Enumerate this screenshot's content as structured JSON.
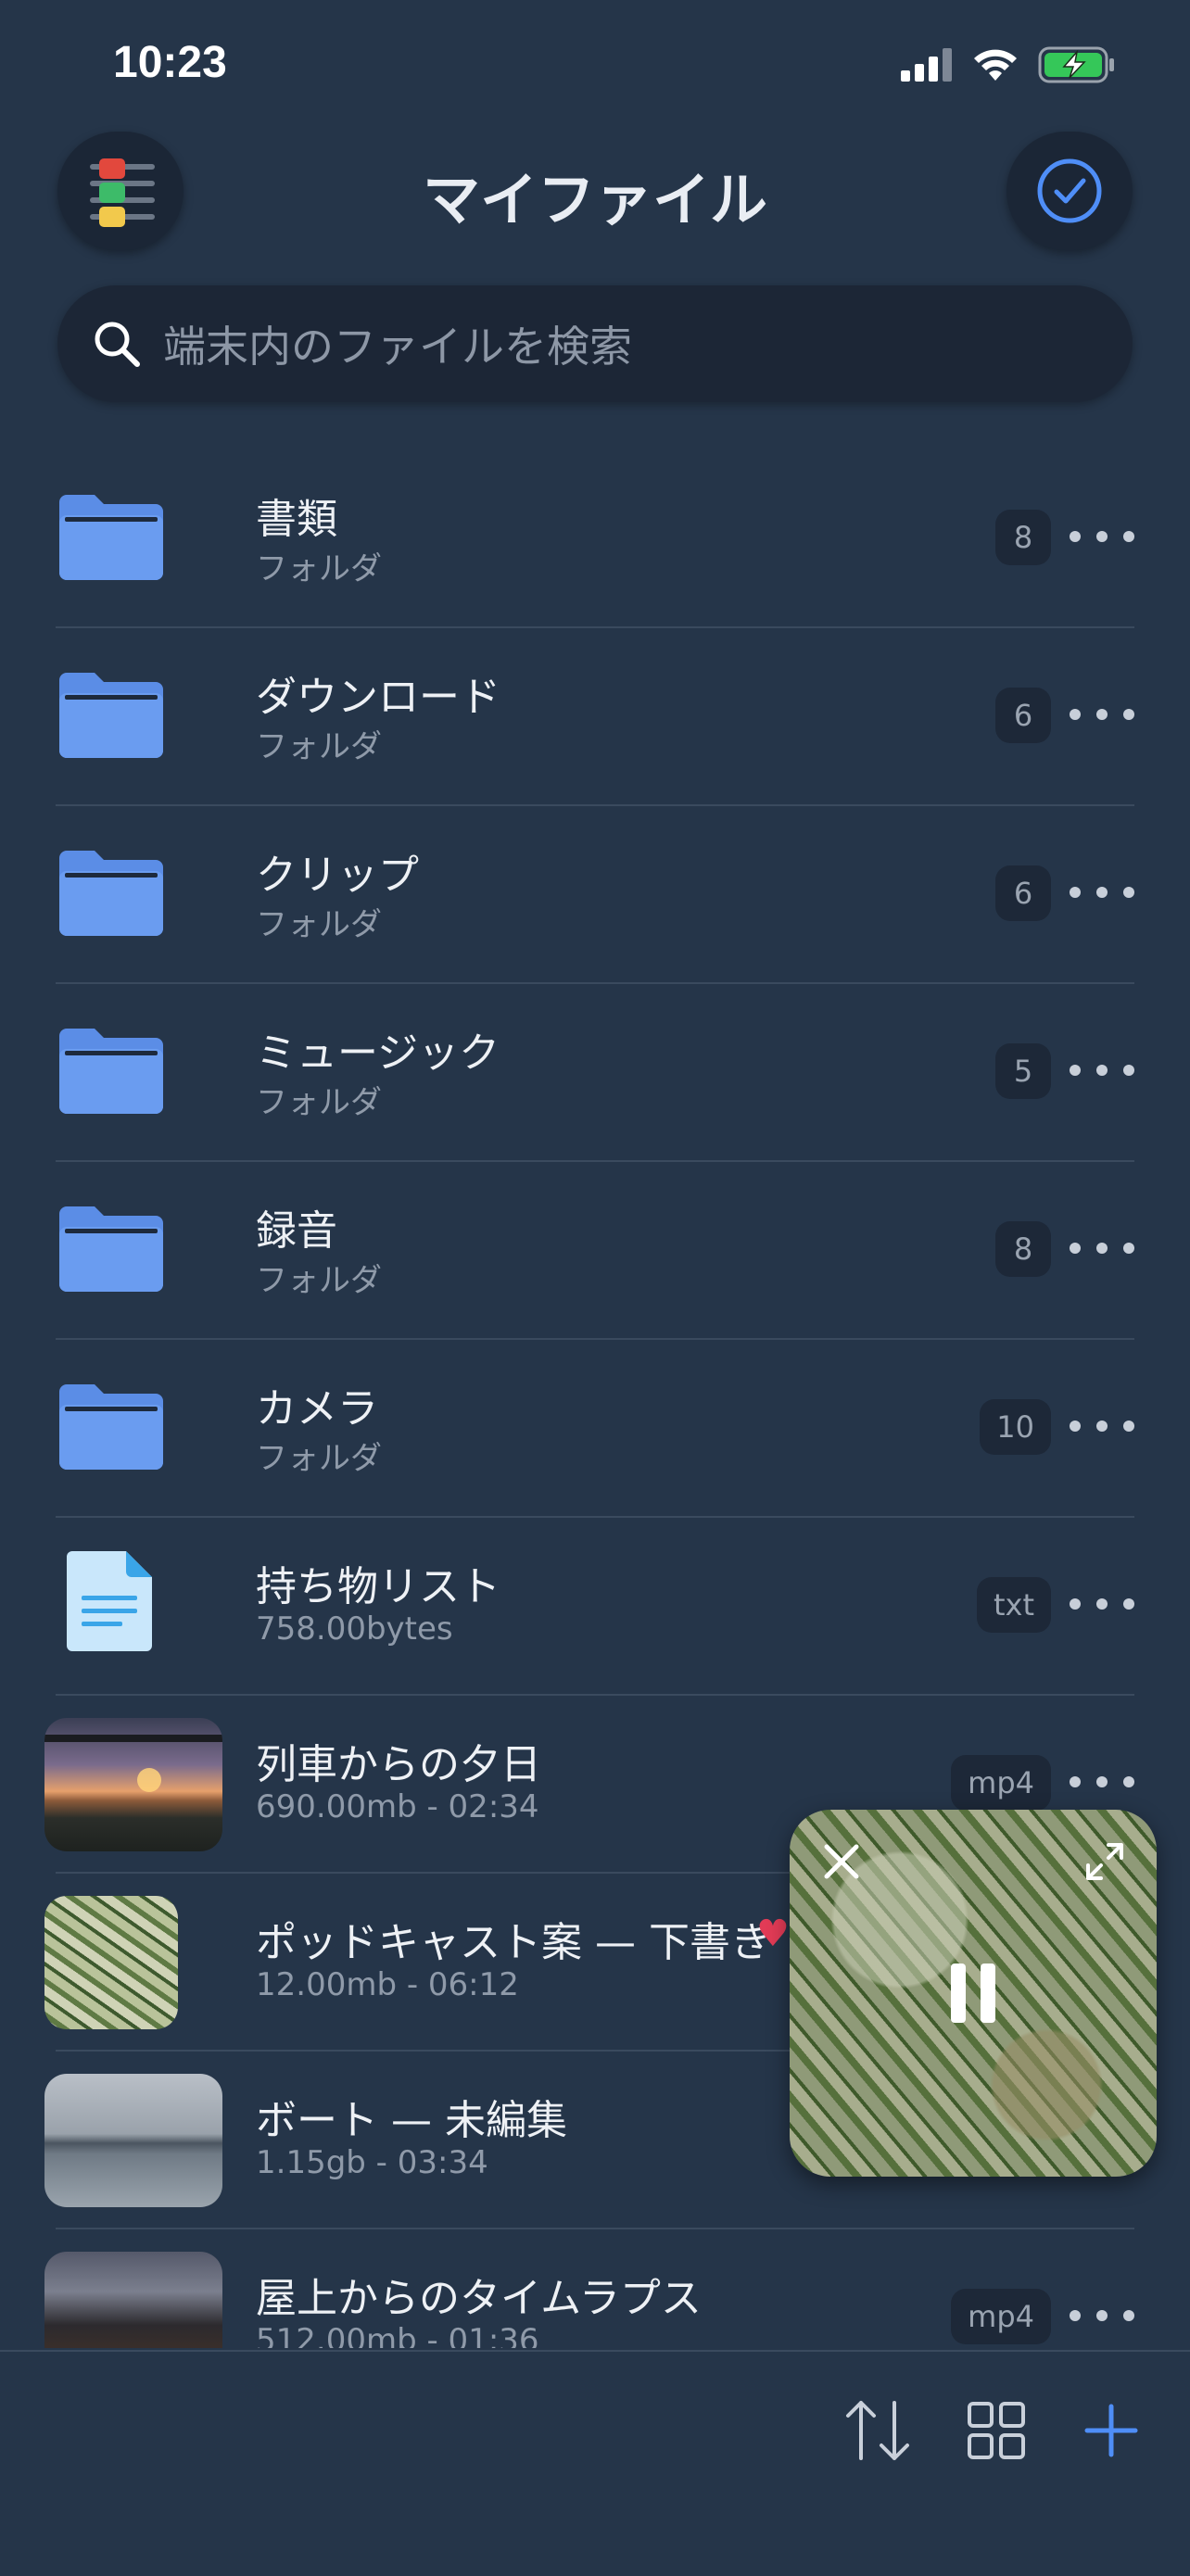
{
  "status_bar": {
    "time": "10:23"
  },
  "header": {
    "title": "マイファイル"
  },
  "search": {
    "placeholder": "端末内のファイルを検索"
  },
  "colors": {
    "accent": "#4f8ef7",
    "folder": "#5b8de6",
    "heart": "#e23b56",
    "background": "#253549"
  },
  "items": [
    {
      "name": "書類",
      "sub": "フォルダ",
      "badge": "8",
      "type": "folder"
    },
    {
      "name": "ダウンロード",
      "sub": "フォルダ",
      "badge": "6",
      "type": "folder"
    },
    {
      "name": "クリップ",
      "sub": "フォルダ",
      "badge": "6",
      "type": "folder"
    },
    {
      "name": "ミュージック",
      "sub": "フォルダ",
      "badge": "5",
      "type": "folder"
    },
    {
      "name": "録音",
      "sub": "フォルダ",
      "badge": "8",
      "type": "folder"
    },
    {
      "name": "カメラ",
      "sub": "フォルダ",
      "badge": "10",
      "type": "folder"
    },
    {
      "name": "持ち物リスト",
      "sub": "758.00bytes",
      "badge": "txt",
      "type": "text-file"
    },
    {
      "name": "列車からの夕日",
      "sub": "690.00mb - 02:34",
      "badge": "mp4",
      "type": "video"
    },
    {
      "name": "ポッドキャスト案 — 下書き",
      "sub": "12.00mb - 06:12",
      "badge": "",
      "type": "audio",
      "favorite": true
    },
    {
      "name": "ボート — 未編集",
      "sub": "1.15gb - 03:34",
      "badge": "",
      "type": "video"
    },
    {
      "name": "屋上からのタイムラプス",
      "sub": "512.00mb - 01:36",
      "badge": "mp4",
      "type": "video"
    }
  ],
  "toolbar": {
    "icons": [
      "sort-icon",
      "grid-view-icon",
      "add-icon"
    ]
  },
  "player": {
    "state": "playing",
    "icons": [
      "close-icon",
      "expand-icon",
      "pause-icon"
    ]
  }
}
